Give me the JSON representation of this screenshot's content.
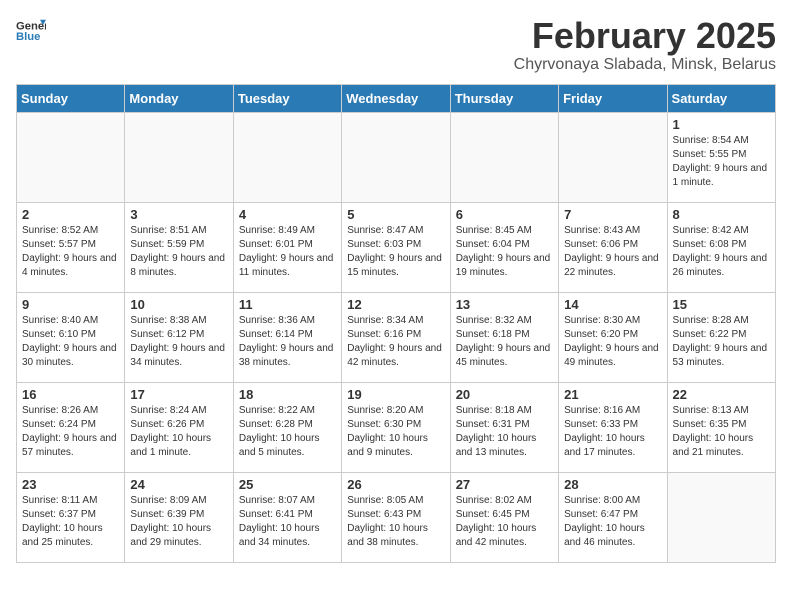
{
  "logo": {
    "general": "General",
    "blue": "Blue"
  },
  "title": "February 2025",
  "subtitle": "Chyrvonaya Slabada, Minsk, Belarus",
  "weekdays": [
    "Sunday",
    "Monday",
    "Tuesday",
    "Wednesday",
    "Thursday",
    "Friday",
    "Saturday"
  ],
  "weeks": [
    [
      {
        "day": "",
        "info": ""
      },
      {
        "day": "",
        "info": ""
      },
      {
        "day": "",
        "info": ""
      },
      {
        "day": "",
        "info": ""
      },
      {
        "day": "",
        "info": ""
      },
      {
        "day": "",
        "info": ""
      },
      {
        "day": "1",
        "info": "Sunrise: 8:54 AM\nSunset: 5:55 PM\nDaylight: 9 hours and 1 minute."
      }
    ],
    [
      {
        "day": "2",
        "info": "Sunrise: 8:52 AM\nSunset: 5:57 PM\nDaylight: 9 hours and 4 minutes."
      },
      {
        "day": "3",
        "info": "Sunrise: 8:51 AM\nSunset: 5:59 PM\nDaylight: 9 hours and 8 minutes."
      },
      {
        "day": "4",
        "info": "Sunrise: 8:49 AM\nSunset: 6:01 PM\nDaylight: 9 hours and 11 minutes."
      },
      {
        "day": "5",
        "info": "Sunrise: 8:47 AM\nSunset: 6:03 PM\nDaylight: 9 hours and 15 minutes."
      },
      {
        "day": "6",
        "info": "Sunrise: 8:45 AM\nSunset: 6:04 PM\nDaylight: 9 hours and 19 minutes."
      },
      {
        "day": "7",
        "info": "Sunrise: 8:43 AM\nSunset: 6:06 PM\nDaylight: 9 hours and 22 minutes."
      },
      {
        "day": "8",
        "info": "Sunrise: 8:42 AM\nSunset: 6:08 PM\nDaylight: 9 hours and 26 minutes."
      }
    ],
    [
      {
        "day": "9",
        "info": "Sunrise: 8:40 AM\nSunset: 6:10 PM\nDaylight: 9 hours and 30 minutes."
      },
      {
        "day": "10",
        "info": "Sunrise: 8:38 AM\nSunset: 6:12 PM\nDaylight: 9 hours and 34 minutes."
      },
      {
        "day": "11",
        "info": "Sunrise: 8:36 AM\nSunset: 6:14 PM\nDaylight: 9 hours and 38 minutes."
      },
      {
        "day": "12",
        "info": "Sunrise: 8:34 AM\nSunset: 6:16 PM\nDaylight: 9 hours and 42 minutes."
      },
      {
        "day": "13",
        "info": "Sunrise: 8:32 AM\nSunset: 6:18 PM\nDaylight: 9 hours and 45 minutes."
      },
      {
        "day": "14",
        "info": "Sunrise: 8:30 AM\nSunset: 6:20 PM\nDaylight: 9 hours and 49 minutes."
      },
      {
        "day": "15",
        "info": "Sunrise: 8:28 AM\nSunset: 6:22 PM\nDaylight: 9 hours and 53 minutes."
      }
    ],
    [
      {
        "day": "16",
        "info": "Sunrise: 8:26 AM\nSunset: 6:24 PM\nDaylight: 9 hours and 57 minutes."
      },
      {
        "day": "17",
        "info": "Sunrise: 8:24 AM\nSunset: 6:26 PM\nDaylight: 10 hours and 1 minute."
      },
      {
        "day": "18",
        "info": "Sunrise: 8:22 AM\nSunset: 6:28 PM\nDaylight: 10 hours and 5 minutes."
      },
      {
        "day": "19",
        "info": "Sunrise: 8:20 AM\nSunset: 6:30 PM\nDaylight: 10 hours and 9 minutes."
      },
      {
        "day": "20",
        "info": "Sunrise: 8:18 AM\nSunset: 6:31 PM\nDaylight: 10 hours and 13 minutes."
      },
      {
        "day": "21",
        "info": "Sunrise: 8:16 AM\nSunset: 6:33 PM\nDaylight: 10 hours and 17 minutes."
      },
      {
        "day": "22",
        "info": "Sunrise: 8:13 AM\nSunset: 6:35 PM\nDaylight: 10 hours and 21 minutes."
      }
    ],
    [
      {
        "day": "23",
        "info": "Sunrise: 8:11 AM\nSunset: 6:37 PM\nDaylight: 10 hours and 25 minutes."
      },
      {
        "day": "24",
        "info": "Sunrise: 8:09 AM\nSunset: 6:39 PM\nDaylight: 10 hours and 29 minutes."
      },
      {
        "day": "25",
        "info": "Sunrise: 8:07 AM\nSunset: 6:41 PM\nDaylight: 10 hours and 34 minutes."
      },
      {
        "day": "26",
        "info": "Sunrise: 8:05 AM\nSunset: 6:43 PM\nDaylight: 10 hours and 38 minutes."
      },
      {
        "day": "27",
        "info": "Sunrise: 8:02 AM\nSunset: 6:45 PM\nDaylight: 10 hours and 42 minutes."
      },
      {
        "day": "28",
        "info": "Sunrise: 8:00 AM\nSunset: 6:47 PM\nDaylight: 10 hours and 46 minutes."
      },
      {
        "day": "",
        "info": ""
      }
    ]
  ]
}
